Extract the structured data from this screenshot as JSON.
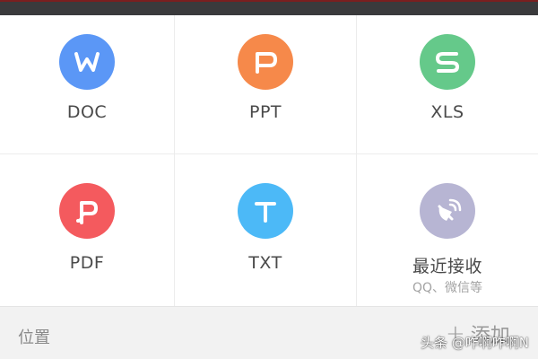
{
  "file_types": [
    {
      "label": "DOC",
      "color": "#5b97f6",
      "icon": "w-letter-icon"
    },
    {
      "label": "PPT",
      "color": "#f6894a",
      "icon": "p-letter-icon"
    },
    {
      "label": "XLS",
      "color": "#65c98a",
      "icon": "s-letter-icon"
    },
    {
      "label": "PDF",
      "color": "#f45a5e",
      "icon": "pdf-icon"
    },
    {
      "label": "TXT",
      "color": "#4cb9f7",
      "icon": "t-letter-icon"
    },
    {
      "label": "最近接收",
      "sublabel": "QQ、微信等",
      "color": "#b7b5d3",
      "icon": "satellite-dish-icon"
    }
  ],
  "bottom_bar": {
    "location_label": "位置",
    "add_label": "添加"
  },
  "watermark": "头条 @咋啊咋啊N"
}
